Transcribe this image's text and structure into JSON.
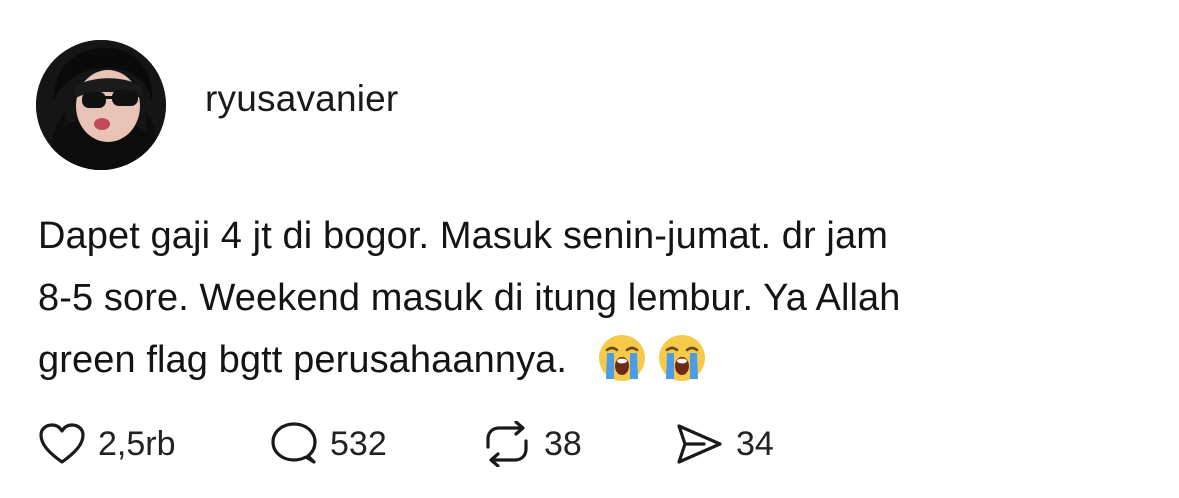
{
  "post": {
    "author": {
      "username": "ryusavanier"
    },
    "text_lines": [
      "Dapet gaji 4 jt di bogor. Masuk senin-jumat. dr jam",
      "8-5 sore. Weekend masuk di itung lembur. Ya Allah",
      "green flag bgtt perusahaannya."
    ],
    "emojis": [
      "loudly-crying-face",
      "loudly-crying-face"
    ],
    "actions": {
      "like": {
        "icon": "heart-icon",
        "count": "2,5rb"
      },
      "reply": {
        "icon": "comment-bubble-icon",
        "count": "532"
      },
      "repost": {
        "icon": "repost-icon",
        "count": "38"
      },
      "share": {
        "icon": "send-icon",
        "count": "34"
      }
    }
  },
  "colors": {
    "text": "#141414",
    "emoji_face": "#f7c948",
    "emoji_tears": "#4a9be8"
  }
}
